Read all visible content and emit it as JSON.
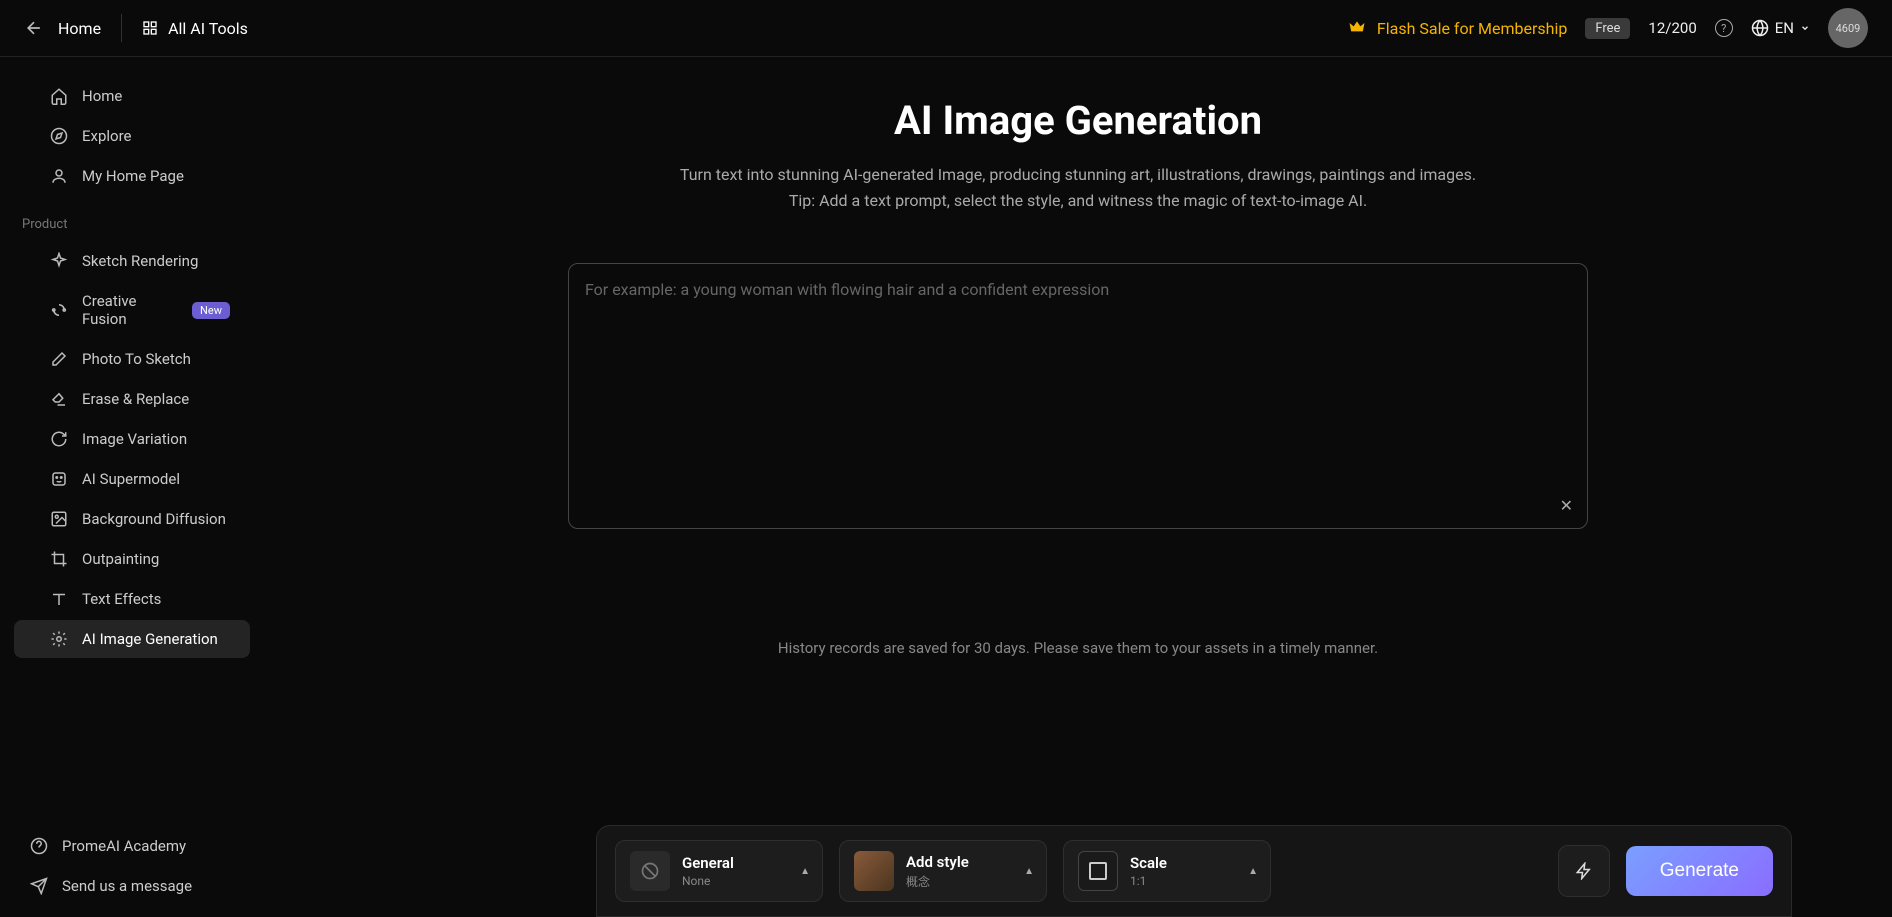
{
  "header": {
    "home": "Home",
    "all_tools": "All AI Tools",
    "flash_sale": "Flash Sale for Membership",
    "free_badge": "Free",
    "credits": "12/200",
    "lang": "EN",
    "avatar": "4609"
  },
  "sidebar": {
    "main": [
      {
        "label": "Home",
        "icon": "home"
      },
      {
        "label": "Explore",
        "icon": "compass"
      },
      {
        "label": "My Home Page",
        "icon": "user"
      }
    ],
    "section_label": "Product",
    "products": [
      {
        "label": "Sketch Rendering",
        "icon": "sparkle"
      },
      {
        "label": "Creative Fusion",
        "icon": "loop",
        "badge": "New"
      },
      {
        "label": "Photo To Sketch",
        "icon": "pencil"
      },
      {
        "label": "Erase & Replace",
        "icon": "eraser"
      },
      {
        "label": "Image Variation",
        "icon": "refresh"
      },
      {
        "label": "AI Supermodel",
        "icon": "face"
      },
      {
        "label": "Background Diffusion",
        "icon": "image"
      },
      {
        "label": "Outpainting",
        "icon": "crop"
      },
      {
        "label": "Text Effects",
        "icon": "text"
      },
      {
        "label": "AI Image Generation",
        "icon": "gear",
        "active": true
      }
    ],
    "footer": [
      {
        "label": "PromeAI Academy",
        "icon": "help"
      },
      {
        "label": "Send us a message",
        "icon": "send"
      }
    ]
  },
  "main": {
    "title": "AI Image Generation",
    "subtitle_1": "Turn text into stunning AI-generated Image, producing stunning art, illustrations, drawings, paintings and images.",
    "subtitle_2": "Tip: Add a text prompt, select the style, and witness the magic of text-to-image AI.",
    "prompt_placeholder": "For example: a young woman with flowing hair and a confident expression",
    "prompt_value": "",
    "history_note": "History records are saved for 30 days. Please save them to your assets in a timely manner."
  },
  "bottom_bar": {
    "general": {
      "title": "General",
      "sub": "None"
    },
    "style": {
      "title": "Add style",
      "sub": "概念"
    },
    "scale": {
      "title": "Scale",
      "sub": "1:1"
    },
    "generate": "Generate"
  }
}
